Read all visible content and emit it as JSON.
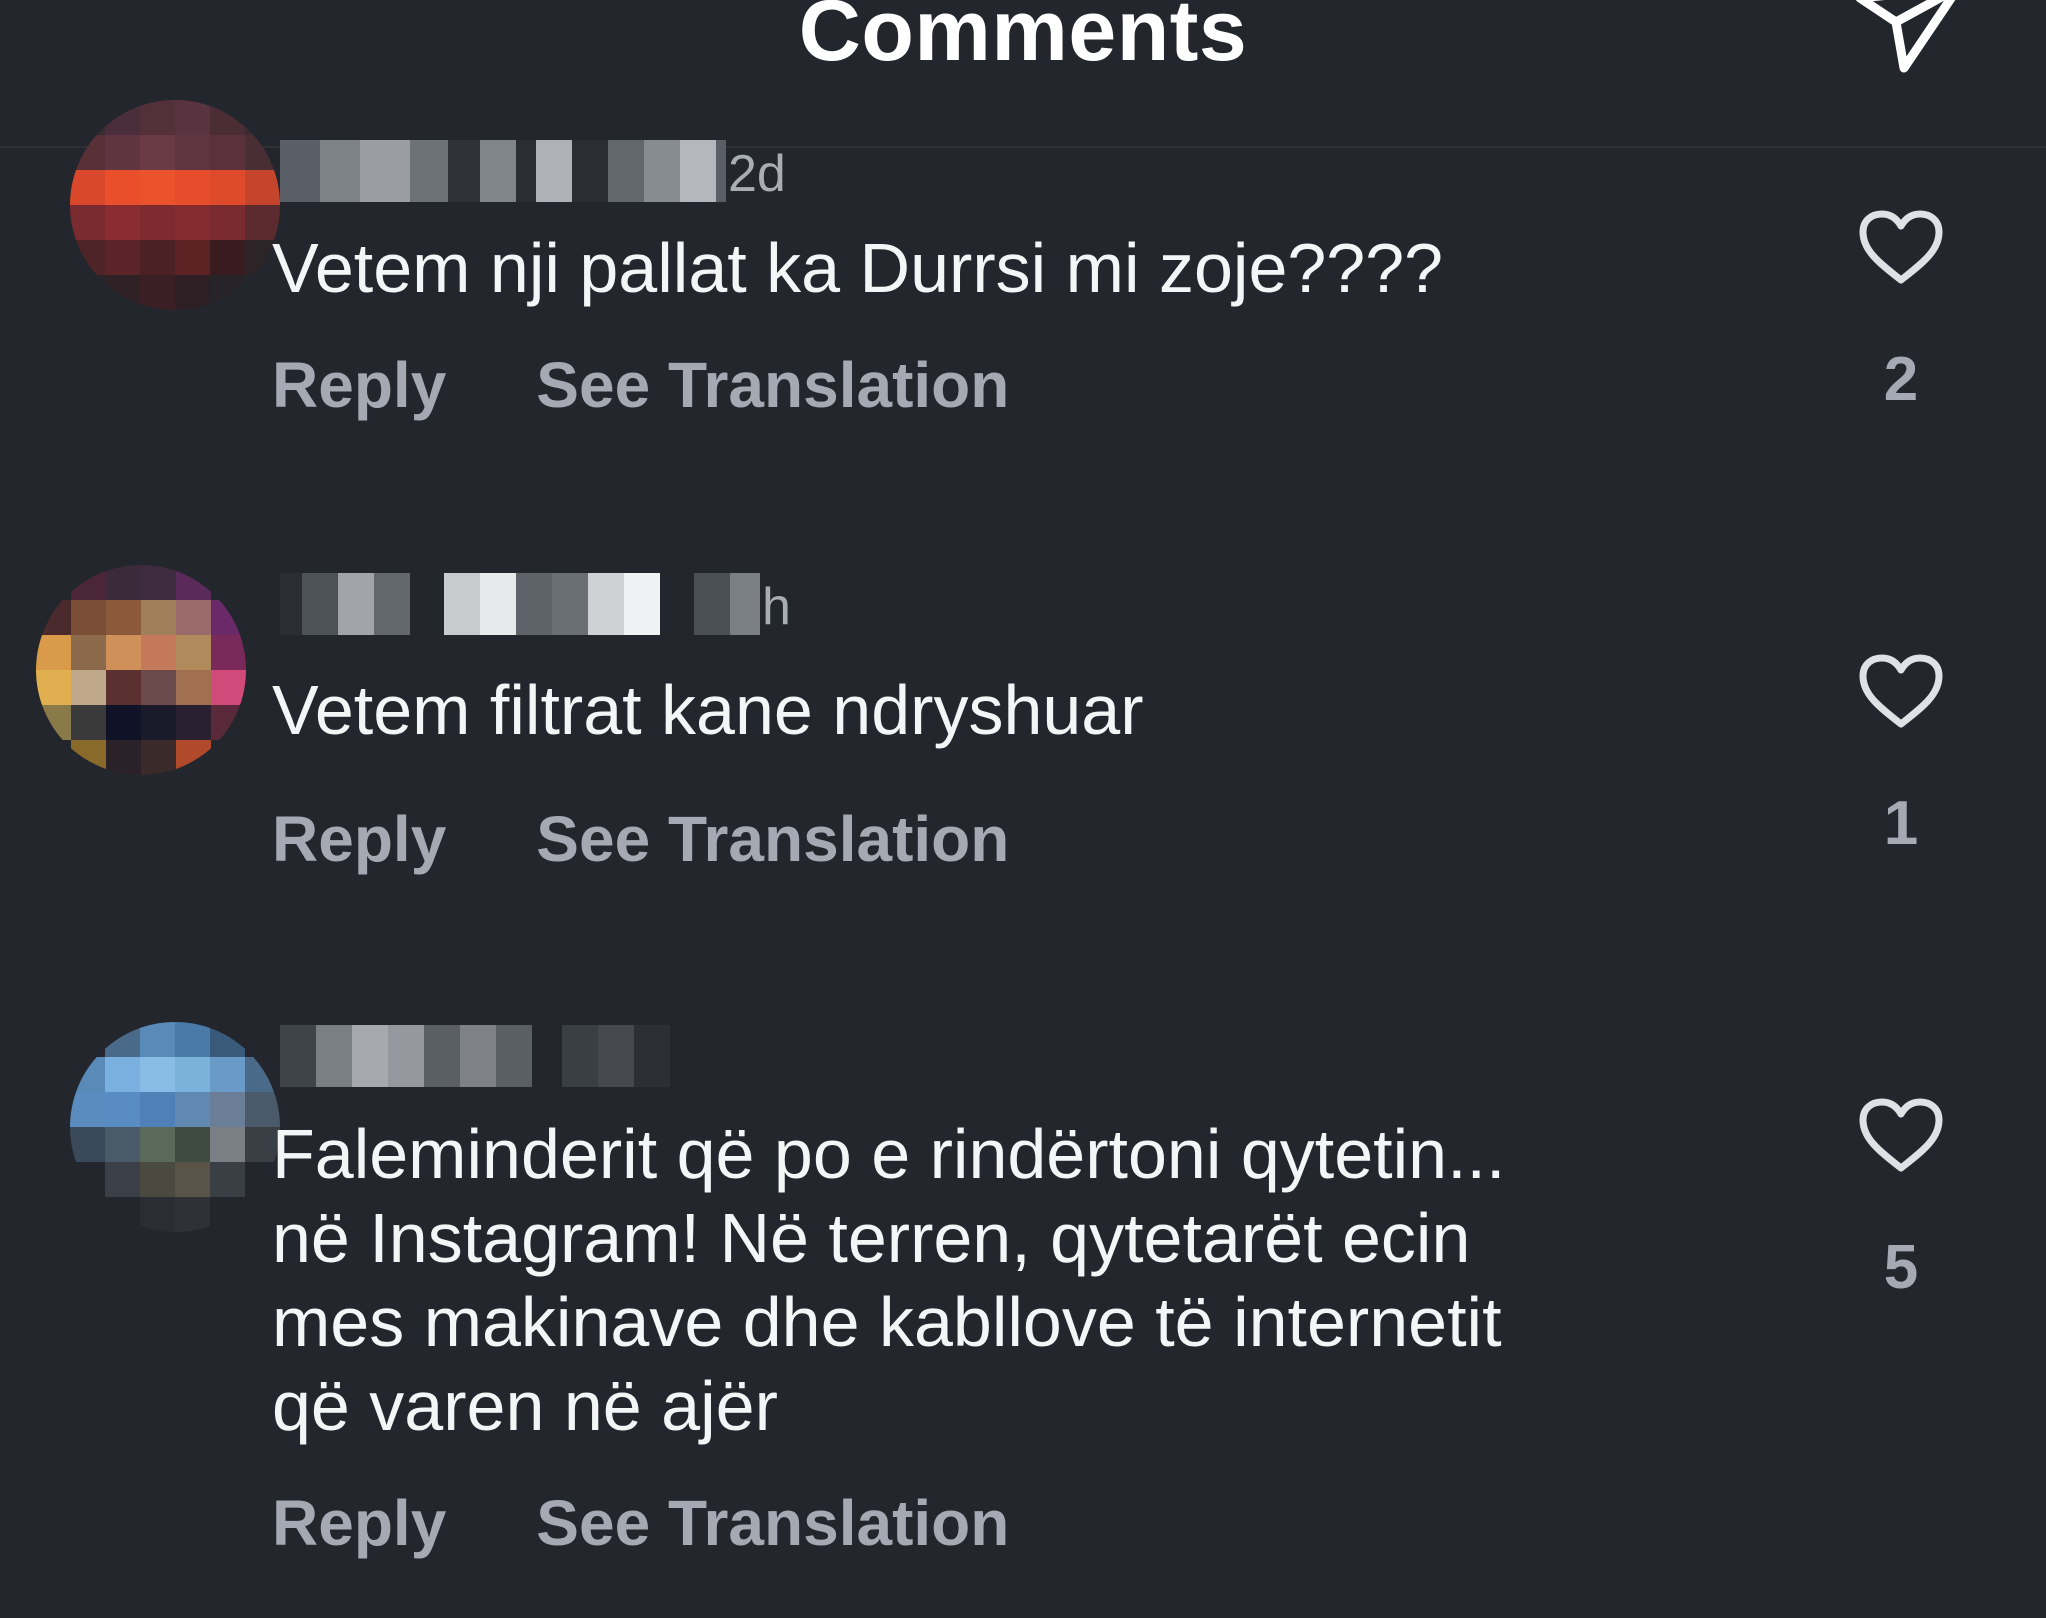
{
  "header": {
    "title": "Comments",
    "share_icon": "paper-plane-icon"
  },
  "comments": [
    {
      "username_timestamp_fragment": "2d",
      "text": "Vetem nji pallat ka Durrsi mi zoje????",
      "reply_label": "Reply",
      "translation_label": "See Translation",
      "like_icon": "heart-outline-icon",
      "like_count": "2"
    },
    {
      "username_timestamp_fragment": "h",
      "text": "Vetem filtrat kane ndryshuar",
      "reply_label": "Reply",
      "translation_label": "See Translation",
      "like_icon": "heart-outline-icon",
      "like_count": "1"
    },
    {
      "username_timestamp_fragment": "",
      "text": "Faleminderit që po e rindërtoni qytetin...\nnë Instagram! Në terren, qytetarët ecin\nmes makinave dhe kabllove të internetit\nqë varen në ajër",
      "reply_label": "Reply",
      "translation_label": "See Translation",
      "like_icon": "heart-outline-icon",
      "like_count": "5"
    }
  ],
  "colors": {
    "background": "#23272d",
    "text_primary": "#f4f5f6",
    "text_secondary": "#a4a9b3"
  }
}
